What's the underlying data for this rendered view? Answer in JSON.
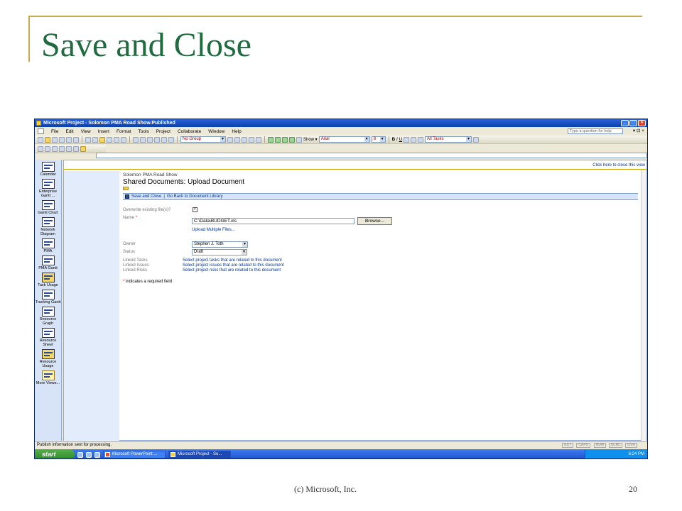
{
  "slide": {
    "title": "Save and Close",
    "copyright": "(c) Microsoft, Inc.",
    "page_number": "20",
    "accent": "#1f6b3f",
    "rule_color": "#c8a94e"
  },
  "window": {
    "title": "Microsoft Project - Solomon PMA Road Show.Published",
    "help_placeholder": "Type a question for help"
  },
  "menu": [
    "File",
    "Edit",
    "View",
    "Insert",
    "Format",
    "Tools",
    "Project",
    "Collaborate",
    "Window",
    "Help"
  ],
  "toolbar": {
    "group": "No Group",
    "show": "Show ▾",
    "font": "Arial",
    "font_size": "8",
    "filter": "All Tasks"
  },
  "view_bar": [
    "Calendar",
    "Enterprise Gantt ...",
    "Gantt Chart",
    "Network Diagram",
    "PMA",
    "PMA Gantt",
    "Task Usage",
    "Tracking Gantt",
    "Resource Graph",
    "Resource Sheet",
    "Resource Usage",
    "More Views..."
  ],
  "page": {
    "close_view": "Click here to close this view",
    "breadcrumb": "Solomon PMA Road Show",
    "heading": "Shared Documents: Upload Document",
    "save_close": "Save and Close",
    "separator": "|",
    "go_back": "Go Back to Document Library"
  },
  "form": {
    "overwrite_label": "Overwrite existing file(s)?",
    "overwrite_check": "✓",
    "name_label": "Name",
    "required_mark": "*",
    "name_value": "C:\\Data\\BUDGET.xls",
    "browse": "Browse...",
    "upload_multiple": "Upload Multiple Files...",
    "owner_label": "Owner",
    "owner_value": "Stephen J. Toth",
    "status_label": "Status",
    "status_value": "Draft",
    "linked_tasks_label": "Linked Tasks",
    "linked_tasks_link": "Select project tasks that are related to this document",
    "linked_issues_label": "Linked Issues",
    "linked_issues_link": "Select project issues that are related to this document",
    "linked_risks_label": "Linked Risks",
    "linked_risks_link": "Select project risks that are related to this document",
    "required_note": "indicates a required field"
  },
  "status": {
    "message": "Publish information sent for processing.",
    "ext": "EXT",
    "caps": "CAPS",
    "num": "NUM",
    "scrl": "SCRL",
    "ovr": "OVR"
  },
  "taskbar": {
    "start": "start",
    "task1": "Microsoft PowerPoint ...",
    "task2": "Microsoft Project - So...",
    "clock": "6:24 PM"
  }
}
